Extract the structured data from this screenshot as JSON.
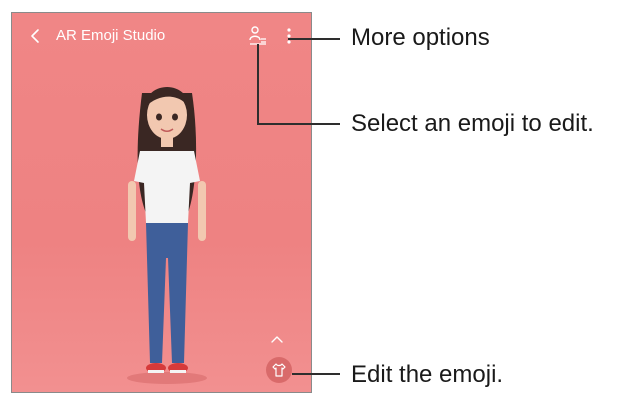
{
  "app": {
    "title": "AR Emoji Studio"
  },
  "icons": {
    "back": "chevron-left-icon",
    "select_emoji": "person-list-icon",
    "more": "more-vertical-icon",
    "expand": "chevron-up-icon",
    "edit": "tshirt-icon"
  },
  "callouts": {
    "more_options": "More options",
    "select_emoji": "Select an emoji to edit.",
    "edit_emoji": "Edit the emoji."
  },
  "colors": {
    "background": "#ee8282",
    "accent": "#d96a6a",
    "text": "#ffffff"
  }
}
